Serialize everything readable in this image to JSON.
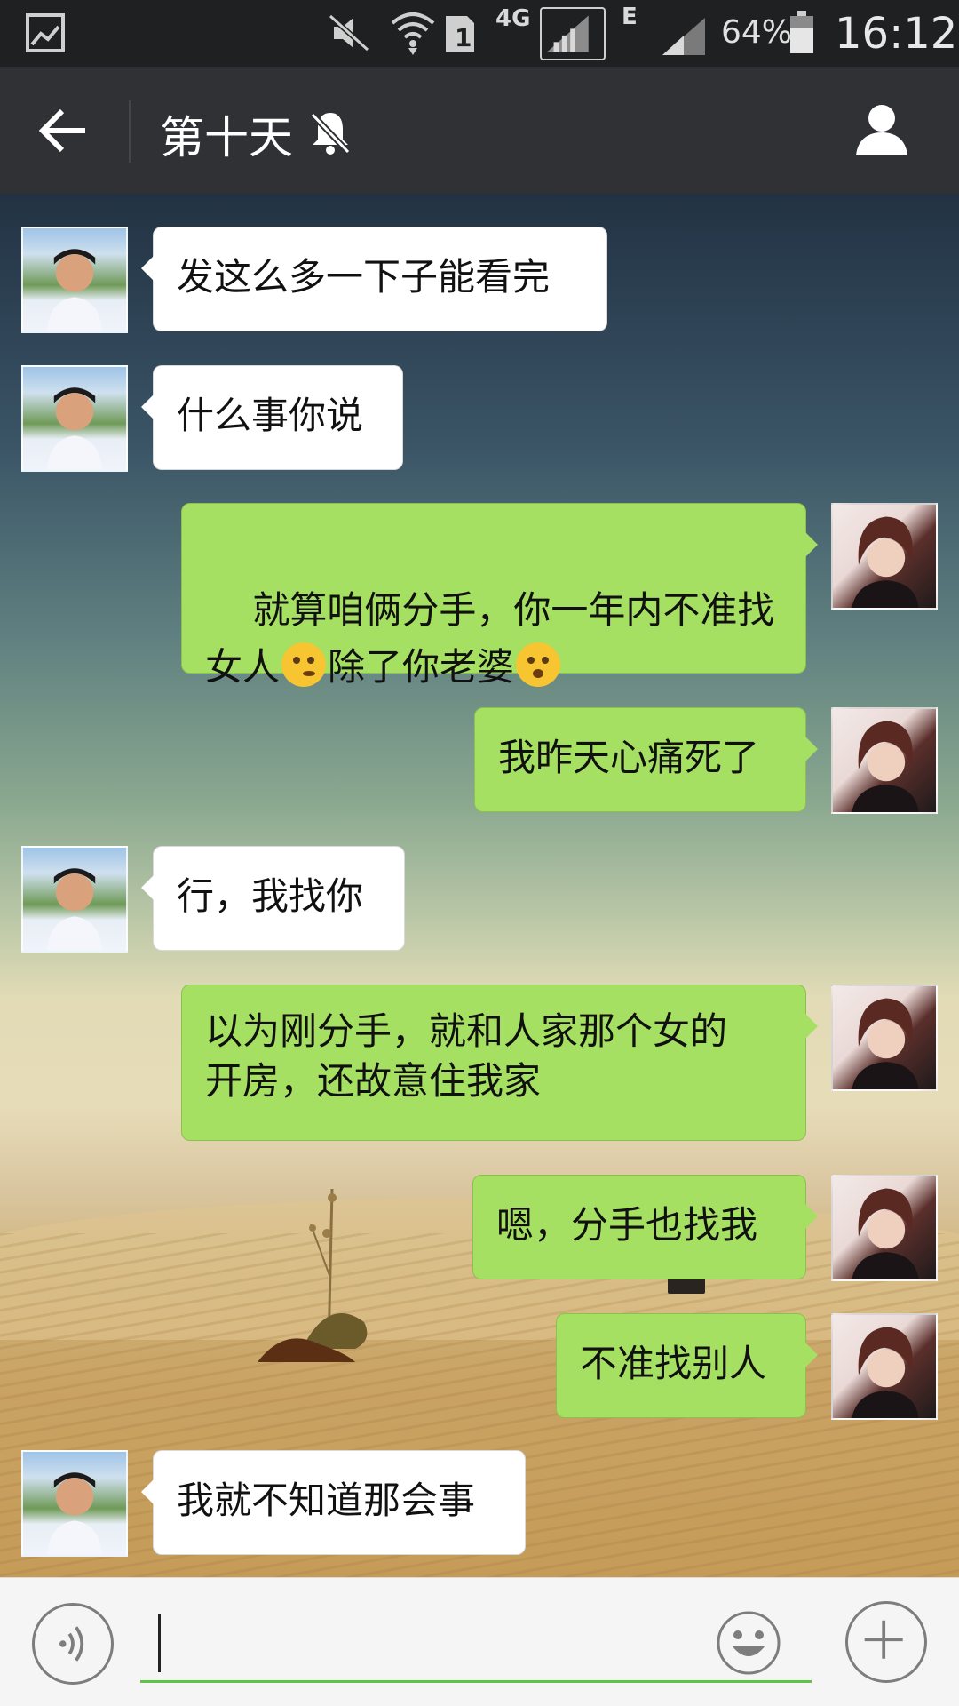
{
  "status_bar": {
    "network_4g": "4G",
    "network_e": "E",
    "battery": "64%",
    "time": "16:12"
  },
  "header": {
    "title": "第十天",
    "muted": true
  },
  "messages": [
    {
      "from": "contact",
      "text": "发这么多一下子能看完"
    },
    {
      "from": "contact",
      "text": "什么事你说"
    },
    {
      "from": "me",
      "text_a": "就算咱俩分手，你一年内不准找",
      "text_b": "女人",
      "text_c": "除了你老婆"
    },
    {
      "from": "me",
      "text": "我昨天心痛死了"
    },
    {
      "from": "contact",
      "text": "行，我找你"
    },
    {
      "from": "me",
      "text": "以为刚分手，就和人家那个女的\n开房，还故意住我家"
    },
    {
      "from": "me",
      "text": "嗯，分手也找我"
    },
    {
      "from": "me",
      "text": "不准找别人"
    },
    {
      "from": "contact",
      "text": "我就不知道那会事"
    }
  ],
  "colors": {
    "outgoing_bubble": "#a5e063",
    "incoming_bubble": "#ffffff",
    "title_bar": "#2f3135",
    "input_underline": "#5ec54a"
  },
  "icons": {
    "status": [
      "gallery-icon",
      "mute-icon",
      "wifi-icon",
      "sim-icon",
      "battery-icon"
    ],
    "header": [
      "back-arrow-icon",
      "bell-off-icon",
      "person-icon"
    ],
    "input": [
      "voice-icon",
      "smiley-icon",
      "plus-icon"
    ]
  }
}
